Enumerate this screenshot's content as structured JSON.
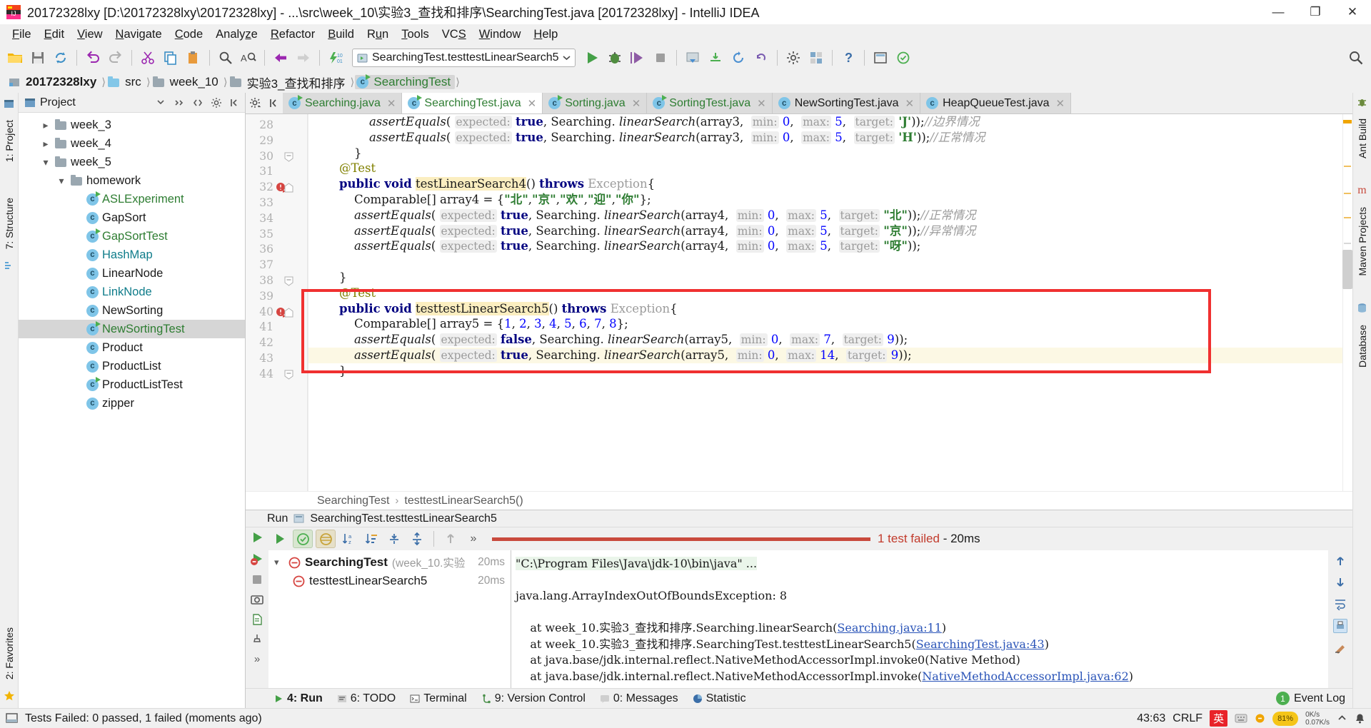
{
  "window": {
    "title": "20172328lxy [D:\\20172328lxy\\20172328lxy] - ...\\src\\week_10\\实验3_查找和排序\\SearchingTest.java [20172328lxy] - IntelliJ IDEA",
    "minimize_label": "—",
    "maximize_label": "❐",
    "close_label": "✕"
  },
  "menubar": {
    "items": [
      {
        "label": "File"
      },
      {
        "label": "Edit"
      },
      {
        "label": "View"
      },
      {
        "label": "Navigate"
      },
      {
        "label": "Code"
      },
      {
        "label": "Analyze"
      },
      {
        "label": "Refactor"
      },
      {
        "label": "Build"
      },
      {
        "label": "Run"
      },
      {
        "label": "Tools"
      },
      {
        "label": "VCS"
      },
      {
        "label": "Window"
      },
      {
        "label": "Help"
      }
    ]
  },
  "toolbar": {
    "run_config": "SearchingTest.testtestLinearSearch5",
    "help_label": "?"
  },
  "breadcrumb": {
    "items": [
      {
        "label": "20172328lxy",
        "type": "module",
        "bold": true
      },
      {
        "label": "src",
        "type": "folder-blue"
      },
      {
        "label": "week_10",
        "type": "folder"
      },
      {
        "label": "实验3_查找和排序",
        "type": "folder"
      },
      {
        "label": "SearchingTest",
        "type": "class",
        "selected": true
      }
    ]
  },
  "left_strip": {
    "tabs": [
      {
        "label": "1: Project"
      },
      {
        "label": "7: Structure"
      },
      {
        "label": "2: Favorites"
      }
    ]
  },
  "right_strip": {
    "tabs": [
      {
        "label": "Ant Build"
      },
      {
        "label": "Maven Projects"
      },
      {
        "label": "Database"
      }
    ]
  },
  "project_panel": {
    "title": "Project",
    "tree": [
      {
        "label": "week_3",
        "indent": 1,
        "type": "folder",
        "arrow": "right"
      },
      {
        "label": "week_4",
        "indent": 1,
        "type": "folder",
        "arrow": "right"
      },
      {
        "label": "week_5",
        "indent": 1,
        "type": "folder",
        "arrow": "down"
      },
      {
        "label": "homework",
        "indent": 2,
        "type": "folder",
        "arrow": "down"
      },
      {
        "label": "ASLExperiment",
        "indent": 3,
        "type": "class-test",
        "color": "green"
      },
      {
        "label": "GapSort",
        "indent": 3,
        "type": "class",
        "color": "dark"
      },
      {
        "label": "GapSortTest",
        "indent": 3,
        "type": "class-test",
        "color": "green"
      },
      {
        "label": "HashMap",
        "indent": 3,
        "type": "class",
        "color": "teal"
      },
      {
        "label": "LinearNode",
        "indent": 3,
        "type": "class",
        "color": "dark"
      },
      {
        "label": "LinkNode",
        "indent": 3,
        "type": "class",
        "color": "teal"
      },
      {
        "label": "NewSorting",
        "indent": 3,
        "type": "class",
        "color": "dark"
      },
      {
        "label": "NewSortingTest",
        "indent": 3,
        "type": "class-test",
        "color": "green",
        "selected": true
      },
      {
        "label": "Product",
        "indent": 3,
        "type": "class",
        "color": "dark"
      },
      {
        "label": "ProductList",
        "indent": 3,
        "type": "class",
        "color": "dark"
      },
      {
        "label": "ProductListTest",
        "indent": 3,
        "type": "class-test",
        "color": "dark"
      },
      {
        "label": "zipper",
        "indent": 3,
        "type": "class",
        "color": "dark"
      }
    ]
  },
  "editor": {
    "tabs": [
      {
        "label": "Searching.java",
        "active": false,
        "color": "green"
      },
      {
        "label": "SearchingTest.java",
        "active": true,
        "color": "green"
      },
      {
        "label": "Sorting.java",
        "active": false,
        "color": "green"
      },
      {
        "label": "SortingTest.java",
        "active": false,
        "color": "green"
      },
      {
        "label": "NewSortingTest.java",
        "active": false,
        "color": "dark"
      },
      {
        "label": "HeapQueueTest.java",
        "active": false,
        "color": "dark"
      }
    ],
    "first_line_number": 28,
    "lines": [
      {
        "num": 28,
        "html": "            <span class=\"sm\">assertEquals</span>( <span class=\"hint\">expected:</span> <span class=\"k\">true</span>, Searching. <span class=\"mth\">linearSearch</span>(array3,  <span class=\"hint\">min:</span> <span class=\"num\">0</span>,  <span class=\"hint\">max:</span> <span class=\"num\">5</span>,  <span class=\"hint\">target:</span> <span class=\"str\">'J'</span>));<span class=\"cmt\">//边界情况</span>"
      },
      {
        "num": 29,
        "html": "            <span class=\"sm\">assertEquals</span>( <span class=\"hint\">expected:</span> <span class=\"k\">true</span>, Searching. <span class=\"mth\">linearSearch</span>(array3,  <span class=\"hint\">min:</span> <span class=\"num\">0</span>,  <span class=\"hint\">max:</span> <span class=\"num\">5</span>,  <span class=\"hint\">target:</span> <span class=\"str\">'H'</span>));<span class=\"cmt\">//正常情况</span>"
      },
      {
        "num": 30,
        "html": "        }"
      },
      {
        "num": 31,
        "html": "    <span class=\"ann\">@Test</span>"
      },
      {
        "num": 32,
        "html": "    <span class=\"k\">public void</span> <span class=\"hlname\">testLinearSearch4</span>() <span class=\"k\">throws</span> <span class=\"plain\" style=\"color:#9b9b9b\">Exception</span>{",
        "bp": true
      },
      {
        "num": 33,
        "html": "        Comparable[] array4 = {<span class=\"str\">\"北\"</span>,<span class=\"str\">\"京\"</span>,<span class=\"str\">\"欢\"</span>,<span class=\"str\">\"迎\"</span>,<span class=\"str\">\"你\"</span>};"
      },
      {
        "num": 34,
        "html": "        <span class=\"sm\">assertEquals</span>( <span class=\"hint\">expected:</span> <span class=\"k\">true</span>, Searching. <span class=\"mth\">linearSearch</span>(array4,  <span class=\"hint\">min:</span> <span class=\"num\">0</span>,  <span class=\"hint\">max:</span> <span class=\"num\">5</span>,  <span class=\"hint\">target:</span> <span class=\"str\">\"北\"</span>));<span class=\"cmt\">//正常情况</span>"
      },
      {
        "num": 35,
        "html": "        <span class=\"sm\">assertEquals</span>( <span class=\"hint\">expected:</span> <span class=\"k\">true</span>, Searching. <span class=\"mth\">linearSearch</span>(array4,  <span class=\"hint\">min:</span> <span class=\"num\">0</span>,  <span class=\"hint\">max:</span> <span class=\"num\">5</span>,  <span class=\"hint\">target:</span> <span class=\"str\">\"京\"</span>));<span class=\"cmt\">//异常情况</span>"
      },
      {
        "num": 36,
        "html": "        <span class=\"sm\">assertEquals</span>( <span class=\"hint\">expected:</span> <span class=\"k\">true</span>, Searching. <span class=\"mth\">linearSearch</span>(array4,  <span class=\"hint\">min:</span> <span class=\"num\">0</span>,  <span class=\"hint\">max:</span> <span class=\"num\">5</span>,  <span class=\"hint\">target:</span> <span class=\"str\">\"呀\"</span>));"
      },
      {
        "num": 37,
        "html": ""
      },
      {
        "num": 38,
        "html": "    }"
      },
      {
        "num": 39,
        "html": "    <span class=\"ann\">@Test</span>"
      },
      {
        "num": 40,
        "html": "    <span class=\"k\">public void</span> <span class=\"hlname\">testtestLinearSearch5</span>() <span class=\"k\">throws</span> <span class=\"plain\" style=\"color:#9b9b9b\">Exception</span>{",
        "bp": true
      },
      {
        "num": 41,
        "html": "        Comparable[] array5 = {<span class=\"num\">1</span>, <span class=\"num\">2</span>, <span class=\"num\">3</span>, <span class=\"num\">4</span>, <span class=\"num\">5</span>, <span class=\"num\">6</span>, <span class=\"num\">7</span>, <span class=\"num\">8</span>};"
      },
      {
        "num": 42,
        "html": "        <span class=\"sm\">assertEquals</span>( <span class=\"hint\">expected:</span> <span class=\"k\">false</span>, Searching. <span class=\"mth\">linearSearch</span>(array5,  <span class=\"hint\">min:</span> <span class=\"num\">0</span>,  <span class=\"hint\">max:</span> <span class=\"num\">7</span>,  <span class=\"hint\">target:</span> <span class=\"num\">9</span>));"
      },
      {
        "num": 43,
        "html": "        <span class=\"sm\">assertEquals</span>( <span class=\"hint\">expected:</span> <span class=\"k\">true</span>, Searching. <span class=\"mth\">linearSearch</span>(array5,  <span class=\"hint\">min:</span> <span class=\"num\">0</span>,  <span class=\"hint\">max:</span> <span class=\"num\">14</span>,  <span class=\"hint\">target:</span> <span class=\"num\">9</span>));",
        "highlight": true
      },
      {
        "num": 44,
        "html": "    }"
      }
    ],
    "status_breadcrumb": [
      "SearchingTest",
      "testtestLinearSearch5()"
    ]
  },
  "run_window": {
    "header_label": "Run",
    "header_config": "SearchingTest.testtestLinearSearch5",
    "progress_text": "1 test failed",
    "progress_time": "- 20ms",
    "test_tree": [
      {
        "label": "SearchingTest",
        "detail": "(week_10.实验",
        "time": "20ms",
        "indent": 0,
        "status": "failed"
      },
      {
        "label": "testtestLinearSearch5",
        "detail": "",
        "time": "20ms",
        "indent": 1,
        "status": "failed"
      }
    ],
    "console": [
      {
        "text": "\"C:\\Program Files\\Java\\jdk-10\\bin\\java\" ...",
        "style": "cmd"
      },
      {
        "text": "",
        "style": "plain"
      },
      {
        "text": "java.lang.ArrayIndexOutOfBoundsException: 8",
        "style": "plain"
      },
      {
        "text": "",
        "style": "plain"
      },
      {
        "text": "    at week_10.实验3_查找和排序.Searching.linearSearch(",
        "link": "Searching.java:11",
        "tail": ")",
        "style": "trace"
      },
      {
        "text": "    at week_10.实验3_查找和排序.SearchingTest.testtestLinearSearch5(",
        "link": "SearchingTest.java:43",
        "tail": ")",
        "style": "trace"
      },
      {
        "text": "    at java.base/jdk.internal.reflect.NativeMethodAccessorImpl.invoke0(Native Method)",
        "style": "trace"
      },
      {
        "text": "    at java.base/jdk.internal.reflect.NativeMethodAccessorImpl.invoke(",
        "link": "NativeMethodAccessorImpl.java:62",
        "tail": ")",
        "style": "trace"
      }
    ]
  },
  "bottom_tabs": {
    "items": [
      {
        "label": "4: Run",
        "icon": "run-icon",
        "active": true
      },
      {
        "label": "6: TODO",
        "icon": "todo-icon",
        "active": false
      },
      {
        "label": "Terminal",
        "icon": "terminal-icon",
        "active": false
      },
      {
        "label": "9: Version Control",
        "icon": "vcs-icon",
        "active": false
      },
      {
        "label": "0: Messages",
        "icon": "messages-icon",
        "active": false
      },
      {
        "label": "Statistic",
        "icon": "statistic-icon",
        "active": false
      }
    ],
    "event_log": "Event Log",
    "event_count": "1"
  },
  "statusbar": {
    "message": "Tests Failed: 0 passed, 1 failed (moments ago)",
    "caret": "43:63",
    "line_sep": "CRLF",
    "ime": "英",
    "battery": "81%",
    "net_up": "0K/s",
    "net_down": "0.07K/s"
  },
  "colors": {
    "accent_red": "#f03030",
    "fail_red": "#c94a3d",
    "green": "#2e7d32",
    "keyword_blue": "#000080",
    "number_blue": "#0000ff"
  }
}
